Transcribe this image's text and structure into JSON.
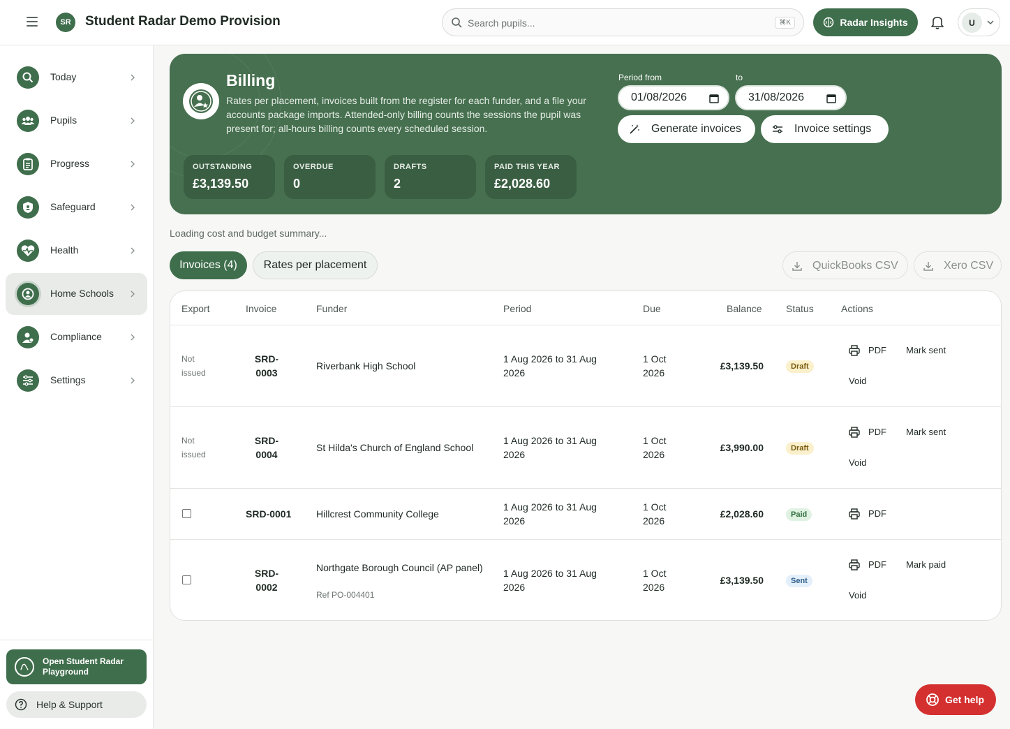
{
  "app": {
    "title": "Student Radar Demo Provision",
    "logo_text": "SR"
  },
  "header": {
    "search_placeholder": "Search pupils...",
    "search_shortcut": "⌘K",
    "insights_label": "Radar Insights",
    "avatar_initial": "U"
  },
  "sidebar": {
    "items": [
      {
        "label": "Today",
        "icon": "search-icon",
        "active": false
      },
      {
        "label": "Pupils",
        "icon": "people-icon",
        "active": false
      },
      {
        "label": "Progress",
        "icon": "clipboard-icon",
        "active": false
      },
      {
        "label": "Safeguard",
        "icon": "shield-icon",
        "active": false
      },
      {
        "label": "Health",
        "icon": "heart-pulse-icon",
        "active": false
      },
      {
        "label": "Home Schools",
        "icon": "school-icon",
        "active": true
      },
      {
        "label": "Compliance",
        "icon": "person-badge-icon",
        "active": false
      },
      {
        "label": "Settings",
        "icon": "sliders-icon",
        "active": false
      }
    ],
    "playground_label": "Open Student Radar Playground",
    "help_label": "Help & Support"
  },
  "billing": {
    "title": "Billing",
    "description": "Rates per placement, invoices built from the register for each funder, and a file your accounts package imports. Attended-only billing counts the sessions the pupil was present for; all-hours billing counts every scheduled session.",
    "stats": [
      {
        "label": "OUTSTANDING",
        "value": "£3,139.50"
      },
      {
        "label": "OVERDUE",
        "value": "0"
      },
      {
        "label": "DRAFTS",
        "value": "2"
      },
      {
        "label": "PAID THIS YEAR",
        "value": "£2,028.60"
      }
    ],
    "period_from_label": "Period from",
    "period_to_label": "to",
    "period_from": "01/08/2026",
    "period_to": "31/08/2026",
    "generate_label": "Generate invoices",
    "settings_label": "Invoice settings"
  },
  "loading_text": "Loading cost and budget summary...",
  "tabs": {
    "invoices": "Invoices (4)",
    "rates": "Rates per placement"
  },
  "exports": {
    "quickbooks": "QuickBooks CSV",
    "xero": "Xero CSV"
  },
  "table": {
    "headers": [
      "Export",
      "Invoice",
      "Funder",
      "Period",
      "Due",
      "Balance",
      "Status",
      "Actions"
    ],
    "rows": [
      {
        "export": "Not issued",
        "invoice": "SRD-0003",
        "funder": "Riverbank High School",
        "ref": "",
        "period": "1 Aug 2026 to 31 Aug 2026",
        "due": "1 Oct 2026",
        "balance": "£3,139.50",
        "status": "Draft",
        "pdf": "PDF",
        "action2": "Mark sent",
        "action3": "Void"
      },
      {
        "export": "Not issued",
        "invoice": "SRD-0004",
        "funder": "St Hilda's Church of England School",
        "ref": "",
        "period": "1 Aug 2026 to 31 Aug 2026",
        "due": "1 Oct 2026",
        "balance": "£3,990.00",
        "status": "Draft",
        "pdf": "PDF",
        "action2": "Mark sent",
        "action3": "Void"
      },
      {
        "export": "",
        "invoice": "SRD-0001",
        "funder": "Hillcrest Community College",
        "ref": "",
        "period": "1 Aug 2026 to 31 Aug 2026",
        "due": "1 Oct 2026",
        "balance": "£2,028.60",
        "status": "Paid",
        "pdf": "PDF",
        "action2": "",
        "action3": ""
      },
      {
        "export": "",
        "invoice": "SRD-0002",
        "funder": "Northgate Borough Council (AP panel)",
        "ref": "Ref PO-004401",
        "period": "1 Aug 2026 to 31 Aug 2026",
        "due": "1 Oct 2026",
        "balance": "£3,139.50",
        "status": "Sent",
        "pdf": "PDF",
        "action2": "Mark paid",
        "action3": "Void"
      }
    ]
  },
  "get_help_label": "Get help",
  "colors": {
    "brand": "#3f6e4c",
    "hero": "#46704f",
    "danger": "#d3302f"
  }
}
